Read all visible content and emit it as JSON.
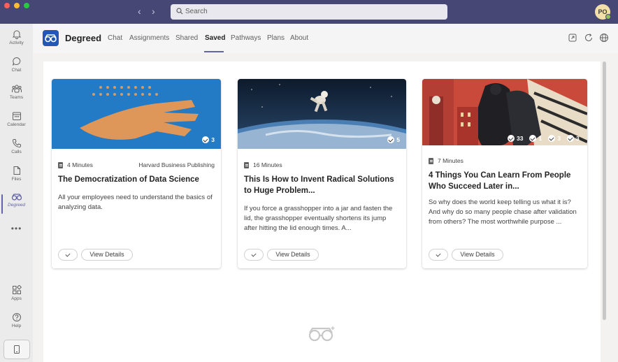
{
  "topbar": {
    "search_placeholder": "Search",
    "avatar_initials": "PO"
  },
  "rail": {
    "items": [
      {
        "label": "Activity",
        "icon": "bell-icon"
      },
      {
        "label": "Chat",
        "icon": "chat-icon"
      },
      {
        "label": "Teams",
        "icon": "teams-icon"
      },
      {
        "label": "Calendar",
        "icon": "calendar-icon"
      },
      {
        "label": "Calls",
        "icon": "phone-icon"
      },
      {
        "label": "Files",
        "icon": "file-icon"
      },
      {
        "label": "Degreed",
        "icon": "degreed-glasses-icon"
      },
      {
        "label": "Apps",
        "icon": "apps-icon"
      },
      {
        "label": "Help",
        "icon": "help-icon"
      }
    ],
    "more": "•••"
  },
  "app": {
    "name": "Degreed",
    "tabs": [
      "Chat",
      "Assignments",
      "Shared",
      "Saved",
      "Pathways",
      "Plans",
      "About"
    ],
    "active_tab": "Saved"
  },
  "cards": [
    {
      "image_stats": [
        {
          "icon": "check-icon",
          "value": "3"
        }
      ],
      "duration": "4 Minutes",
      "provider": "Harvard Business Publishing",
      "title": "The Democratization of Data Science",
      "description": "All your employees need to understand the basics of analyzing data.",
      "details_label": "View Details"
    },
    {
      "image_stats": [
        {
          "icon": "check-icon",
          "value": "5"
        }
      ],
      "duration": "16 Minutes",
      "provider": "",
      "title": "This Is How to Invent Radical Solutions to Huge Problem...",
      "description": "If you force a grasshopper into a jar and fasten the lid, the grasshopper eventually shortens its jump after hitting the lid enough times. A...",
      "details_label": "View Details"
    },
    {
      "image_stats": [
        {
          "icon": "check-icon",
          "value": "33"
        },
        {
          "icon": "share-icon",
          "value": "1"
        },
        {
          "icon": "comment-icon",
          "value": "3"
        },
        {
          "icon": "thumb-icon",
          "value": "3"
        }
      ],
      "duration": "7 Minutes",
      "provider": "",
      "title": "4 Things You Can Learn From People Who Succeed Later in...",
      "description": "So why does the world keep telling us what it is? And why do so many people chase after validation from others? The most worthwhile purpose ...",
      "details_label": "View Details"
    }
  ],
  "colors": {
    "titlebar": "#464775",
    "accent": "#6264a7",
    "degreed_blue": "#2257b8"
  }
}
